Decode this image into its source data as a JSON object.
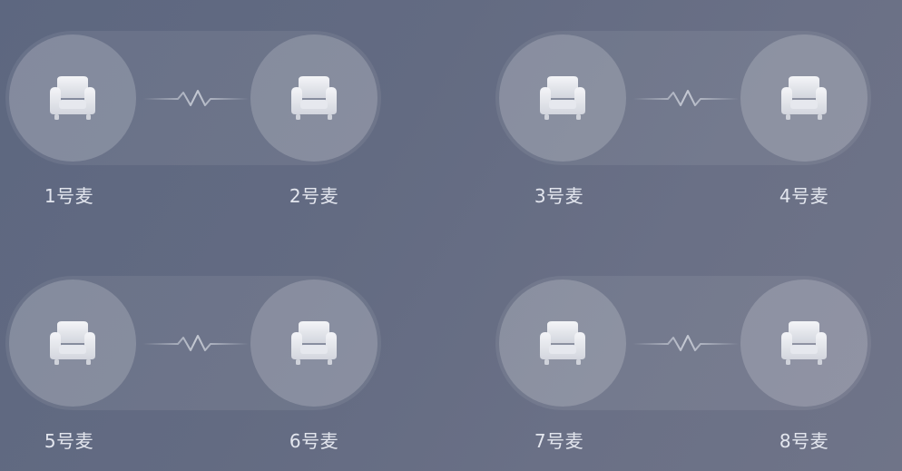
{
  "seats": [
    {
      "label": "1号麦",
      "icon": "armchair-icon"
    },
    {
      "label": "2号麦",
      "icon": "armchair-icon"
    },
    {
      "label": "3号麦",
      "icon": "armchair-icon"
    },
    {
      "label": "4号麦",
      "icon": "armchair-icon"
    },
    {
      "label": "5号麦",
      "icon": "armchair-icon"
    },
    {
      "label": "6号麦",
      "icon": "armchair-icon"
    },
    {
      "label": "7号麦",
      "icon": "armchair-icon"
    },
    {
      "label": "8号麦",
      "icon": "armchair-icon"
    }
  ],
  "link_icon": "heartbeat-link-icon",
  "colors": {
    "background": "#636b82",
    "label": "#e3e6ee",
    "chair": "#eef0f5"
  }
}
